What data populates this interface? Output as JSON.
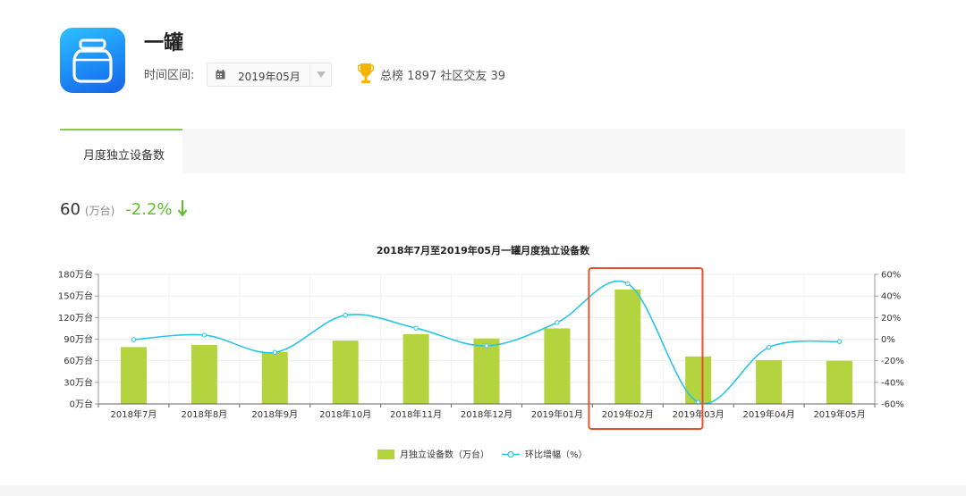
{
  "app": {
    "name": "一罐",
    "range_label": "时间区间:",
    "selected_month": "2019年05月",
    "rank_text": "总榜 1897  社区交友 39"
  },
  "tabs": [
    {
      "label": "月度独立设备数"
    }
  ],
  "metric": {
    "value": "60",
    "unit": "(万台)",
    "change": "-2.2%"
  },
  "colors": {
    "bar": "#b3d33f",
    "line": "#29c4e6",
    "highlight_box": "#e8502f",
    "change_down": "#5fbf2b",
    "tab_accent": "#8dc63f"
  },
  "chart_data": {
    "type": "bar",
    "title": "2018年7月至2019年05月一罐月度独立设备数",
    "categories": [
      "2018年7月",
      "2018年8月",
      "2018年9月",
      "2018年10月",
      "2018年11月",
      "2018年12月",
      "2019年01月",
      "2019年02月",
      "2019年03月",
      "2019年04月",
      "2019年05月"
    ],
    "series": [
      {
        "name": "月独立设备数（万台）",
        "type": "bar",
        "axis": "left",
        "values": [
          79,
          82,
          72,
          88,
          97,
          91,
          105,
          159,
          66,
          61,
          60
        ]
      },
      {
        "name": "环比增幅（%）",
        "type": "line",
        "axis": "right",
        "values": [
          -0.5,
          3.8,
          -12.2,
          22.2,
          10.2,
          -6.2,
          15.4,
          51.4,
          -58.5,
          -7.6,
          -2.2
        ]
      }
    ],
    "y_left": {
      "min": 0,
      "max": 180,
      "ticks": [
        "0万台",
        "30万台",
        "60万台",
        "90万台",
        "120万台",
        "150万台",
        "180万台"
      ]
    },
    "y_right": {
      "min": -60,
      "max": 60,
      "ticks": [
        "-60%",
        "-40%",
        "-20%",
        "0%",
        "20%",
        "40%",
        "60%"
      ]
    },
    "grid": true,
    "legend": "bottom-center",
    "highlight_category": "2019年02月"
  }
}
